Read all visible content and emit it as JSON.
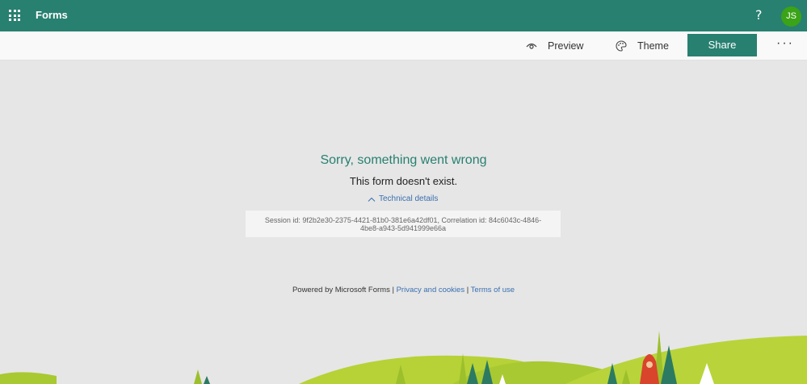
{
  "header": {
    "app_name": "Forms",
    "help_label": "?",
    "avatar_initials": "JS"
  },
  "toolbar": {
    "preview_label": "Preview",
    "theme_label": "Theme",
    "share_label": "Share",
    "more_label": "···"
  },
  "error": {
    "title": "Sorry, something went wrong",
    "message": "This form doesn't exist.",
    "technical_details_label": "Technical details",
    "session_text": "Session id: 9f2b2e30-2375-4421-81b0-381e6a42df01, Correlation id: 84c6043c-4846-4be8-a943-5d941999e66a"
  },
  "footer": {
    "powered_by": "Powered by Microsoft Forms | ",
    "privacy_label": "Privacy and cookies",
    "separator": " | ",
    "terms_label": "Terms of use"
  },
  "colors": {
    "brand": "#288070",
    "avatar": "#3aa317",
    "link": "#3a6fb0",
    "background": "#e6e6e6"
  },
  "icons": [
    "waffle-icon",
    "help-icon",
    "eye-icon",
    "palette-icon",
    "chevron-up-icon"
  ]
}
